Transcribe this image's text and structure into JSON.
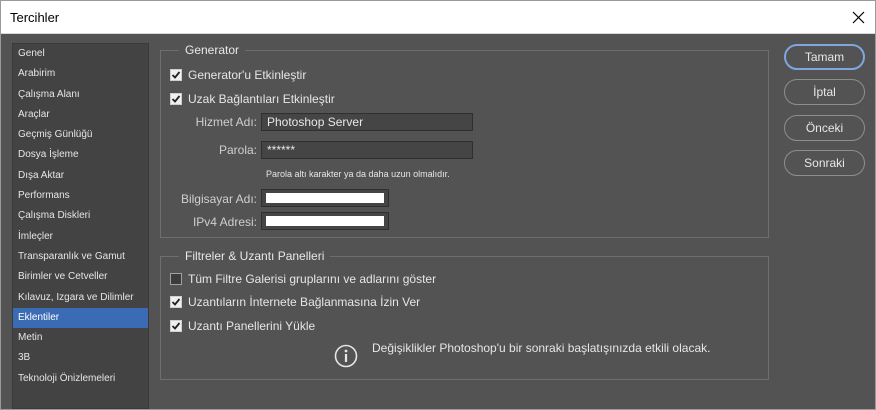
{
  "window": {
    "title": "Tercihler"
  },
  "sidebar": {
    "items": [
      {
        "label": "Genel"
      },
      {
        "label": "Arabirim"
      },
      {
        "label": "Çalışma Alanı"
      },
      {
        "label": "Araçlar"
      },
      {
        "label": "Geçmiş Günlüğü"
      },
      {
        "label": "Dosya İşleme"
      },
      {
        "label": "Dışa Aktar"
      },
      {
        "label": "Performans"
      },
      {
        "label": "Çalışma Diskleri"
      },
      {
        "label": "İmleçler"
      },
      {
        "label": "Transparanlık ve Gamut"
      },
      {
        "label": "Birimler ve Cetveller"
      },
      {
        "label": "Kılavuz, Izgara ve Dilimler"
      },
      {
        "label": "Eklentiler",
        "selected": true
      },
      {
        "label": "Metin"
      },
      {
        "label": "3B"
      },
      {
        "label": "Teknoloji Önizlemeleri"
      }
    ]
  },
  "generator": {
    "title": "Generator",
    "enable_label": "Generator'u Etkinleştir",
    "enable_checked": true,
    "remote_label": "Uzak Bağlantıları Etkinleştir",
    "remote_checked": true,
    "service_name_label": "Hizmet Adı:",
    "service_name_value": "Photoshop Server",
    "password_label": "Parola:",
    "password_value": "******",
    "password_hint": "Parola altı karakter ya da daha uzun olmalıdır.",
    "computer_name_label": "Bilgisayar Adı:",
    "ipv4_label": "IPv4 Adresi:"
  },
  "filters": {
    "title": "Filtreler & Uzantı Panelleri",
    "gallery_label": "Tüm Filtre Galerisi gruplarını ve adlarını göster",
    "gallery_checked": false,
    "extensions_internet_label": "Uzantıların İnternete Bağlanmasına İzin Ver",
    "extensions_internet_checked": true,
    "load_panels_label": "Uzantı Panellerini Yükle",
    "load_panels_checked": true,
    "info_text": "Değişiklikler Photoshop'u bir sonraki başlatışınızda etkili olacak."
  },
  "buttons": {
    "ok": "Tamam",
    "cancel": "İptal",
    "prev": "Önceki",
    "next": "Sonraki"
  },
  "colors": {
    "panel": "#535353",
    "sidebar": "#434343",
    "selection": "#3a6bb4",
    "primary_button_border": "#7fa6e0"
  }
}
